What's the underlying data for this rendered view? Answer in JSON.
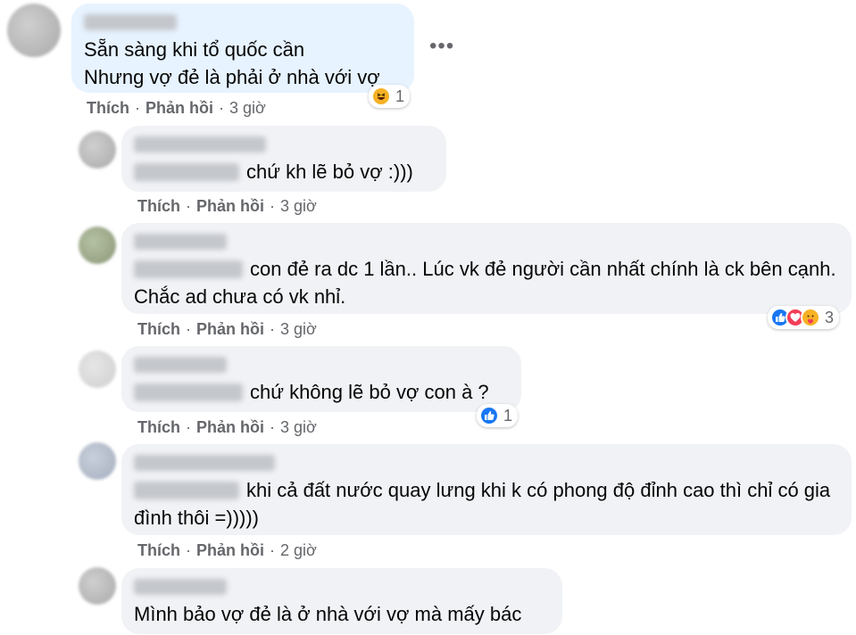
{
  "comments": [
    {
      "text_lines": [
        "Sẵn sàng khi tổ quốc cần",
        "Nhưng vợ đẻ là phải ở nhà với vợ"
      ],
      "like": "Thích",
      "reply": "Phản hồi",
      "time": "3 giờ",
      "reaction": {
        "icons": [
          "haha-icon"
        ],
        "count": "1"
      }
    },
    {
      "text": "chứ kh lẽ bỏ vợ :)))",
      "like": "Thích",
      "reply": "Phản hồi",
      "time": "3 giờ"
    },
    {
      "text": "con đẻ ra dc 1 lần.. Lúc vk đẻ người cần nhất chính là ck bên cạnh. Chắc ad chưa có vk nhỉ.",
      "like": "Thích",
      "reply": "Phản hồi",
      "time": "3 giờ",
      "reaction": {
        "icons": [
          "like-icon",
          "love-icon",
          "care-icon"
        ],
        "count": "3"
      }
    },
    {
      "text": "chứ không lẽ bỏ vợ con à ?",
      "like": "Thích",
      "reply": "Phản hồi",
      "time": "3 giờ",
      "reaction": {
        "icons": [
          "like-icon"
        ],
        "count": "1"
      }
    },
    {
      "text": "khi cả đất nước quay lưng khi k có phong độ đỉnh cao thì chỉ có gia đình thôi =)))))",
      "like": "Thích",
      "reply": "Phản hồi",
      "time": "2 giờ"
    },
    {
      "text": "Mình bảo vợ đẻ là ở nhà với vợ mà mấy bác"
    }
  ],
  "colors": {
    "bubble": "#f0f2f5",
    "highlight_bubble": "#e7f3ff",
    "action_text": "#65676b",
    "like_blue": "#1877f2",
    "love_red": "#f33e58",
    "haha_yellow": "#f7b125"
  }
}
